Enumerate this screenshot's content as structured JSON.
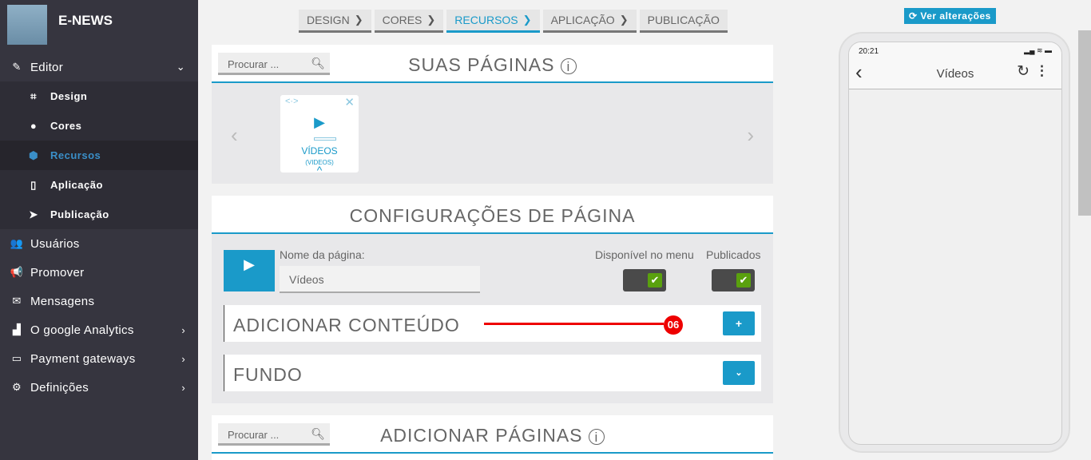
{
  "sidebar": {
    "brand": "E-NEWS",
    "editor": {
      "label": "Editor",
      "icon": "pencil-icon"
    },
    "sub": [
      {
        "label": "Design",
        "icon": "crop-icon"
      },
      {
        "label": "Cores",
        "icon": "palette-icon"
      },
      {
        "label": "Recursos",
        "icon": "cube-icon",
        "active": true
      },
      {
        "label": "Aplicação",
        "icon": "mobile-icon"
      },
      {
        "label": "Publicação",
        "icon": "paper-plane-icon"
      }
    ],
    "items": [
      {
        "label": "Usuários",
        "icon": "users-icon"
      },
      {
        "label": "Promover",
        "icon": "bullhorn-icon"
      },
      {
        "label": "Mensagens",
        "icon": "envelope-icon"
      },
      {
        "label": "O google Analytics",
        "icon": "chart-icon"
      },
      {
        "label": "Payment gateways",
        "icon": "credit-card-icon"
      },
      {
        "label": "Definições",
        "icon": "cogs-icon"
      }
    ]
  },
  "breadcrumb": [
    "DESIGN",
    "CORES",
    "RECURSOS",
    "APLICAÇÃO",
    "PUBLICAÇÃO"
  ],
  "accent": "#1a9ac9",
  "pages": {
    "search_placeholder": "Procurar ...",
    "title": "SUAS PÁGINAS",
    "card": {
      "label": "VÍDEOS",
      "sub": "(VIDEOS)"
    }
  },
  "config": {
    "title": "CONFIGURAÇÕES DE PÁGINA",
    "name_label": "Nome da página:",
    "name_value": "Vídeos",
    "menu_label": "Disponível no menu",
    "published_label": "Publicados",
    "add_content": "ADICIONAR CONTEÚDO",
    "annotation": "06",
    "background": "FUNDO"
  },
  "add_pages": {
    "search_placeholder": "Procurar ...",
    "title": "ADICIONAR PÁGINAS"
  },
  "preview": {
    "button": "Ver alterações",
    "time": "20:21",
    "title": "Vídeos"
  }
}
